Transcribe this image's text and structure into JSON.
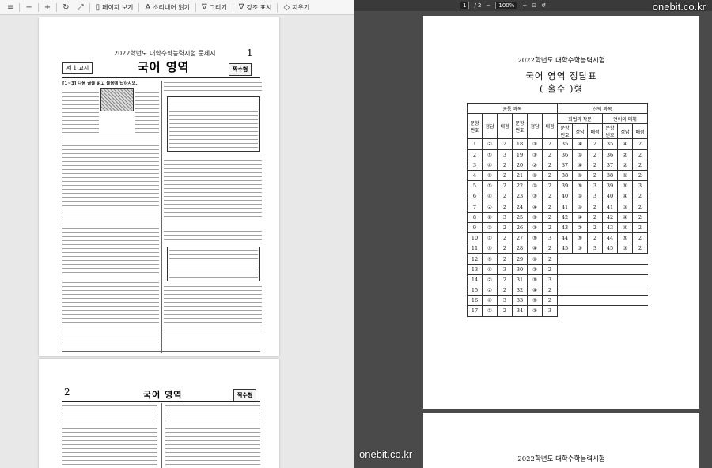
{
  "toolbar": {
    "items": [
      {
        "label": "",
        "icon": "menu-icon"
      },
      {
        "label": "",
        "icon": "minus-icon"
      },
      {
        "label": "",
        "icon": "plus-icon"
      },
      {
        "label": "",
        "icon": "rotate-icon"
      },
      {
        "label": "",
        "icon": "fit-icon"
      },
      {
        "label": "페이지 보기",
        "icon": "page-view-icon"
      },
      {
        "label": "소리내어 읽기",
        "icon": "read-aloud-icon"
      },
      {
        "label": "그리기",
        "icon": "draw-icon"
      },
      {
        "label": "강조 표시",
        "icon": "highlight-icon"
      },
      {
        "label": "지우기",
        "icon": "erase-icon"
      }
    ]
  },
  "left_doc": {
    "page1": {
      "exam_title": "2022학년도 대학수학능력시험 문제지",
      "page_number": "1",
      "session": "제 1 교시",
      "subject": "국어 영역",
      "type_badge": "짝수형",
      "q_intro_1": "[1~3] 다음 글을 읽고 물음에 답하시오."
    },
    "page2": {
      "page_number": "2",
      "subject": "국어 영역",
      "type_badge": "짝수형"
    }
  },
  "right_doc": {
    "toolbar": {
      "page": "1",
      "total": "/ 2",
      "zoom": "100%"
    },
    "watermark_top": "onebit.co.kr",
    "watermark_bottom": "onebit.co.kr",
    "page1": {
      "exam_title": "2022학년도 대학수학능력시험",
      "subject_line": "국어 영역 정답표",
      "type_line": "( 홀수 )형"
    },
    "page2": {
      "exam_title": "2022학년도 대학수학능력시험"
    },
    "table": {
      "group_common": "공통 과목",
      "group_elective": "선택 과목",
      "sub_a": "화법과 작문",
      "sub_b": "언어와 매체",
      "col_num": "문항 번호",
      "col_ans": "정답",
      "col_score": "배점",
      "common": [
        [
          "1",
          "②",
          "2"
        ],
        [
          "2",
          "⑤",
          "3"
        ],
        [
          "3",
          "④",
          "2"
        ],
        [
          "4",
          "①",
          "2"
        ],
        [
          "5",
          "⑤",
          "2"
        ],
        [
          "6",
          "④",
          "2"
        ],
        [
          "7",
          "②",
          "2"
        ],
        [
          "8",
          "②",
          "3"
        ],
        [
          "9",
          "③",
          "2"
        ],
        [
          "10",
          "①",
          "2"
        ],
        [
          "11",
          "⑤",
          "2"
        ],
        [
          "12",
          "⑤",
          "2"
        ],
        [
          "13",
          "④",
          "3"
        ],
        [
          "14",
          "②",
          "2"
        ],
        [
          "15",
          "②",
          "2"
        ],
        [
          "16",
          "④",
          "3"
        ],
        [
          "17",
          "①",
          "2"
        ]
      ],
      "common2": [
        [
          "18",
          "③",
          "2"
        ],
        [
          "19",
          "③",
          "2"
        ],
        [
          "20",
          "②",
          "2"
        ],
        [
          "21",
          "①",
          "2"
        ],
        [
          "22",
          "①",
          "2"
        ],
        [
          "23",
          "③",
          "2"
        ],
        [
          "24",
          "④",
          "2"
        ],
        [
          "25",
          "③",
          "2"
        ],
        [
          "26",
          "③",
          "2"
        ],
        [
          "27",
          "⑤",
          "3"
        ],
        [
          "28",
          "④",
          "2"
        ],
        [
          "29",
          "①",
          "2"
        ],
        [
          "30",
          "③",
          "2"
        ],
        [
          "31",
          "⑤",
          "3"
        ],
        [
          "32",
          "④",
          "2"
        ],
        [
          "33",
          "⑤",
          "2"
        ],
        [
          "34",
          "③",
          "3"
        ]
      ],
      "elective_a": [
        [
          "35",
          "④",
          "2"
        ],
        [
          "36",
          "①",
          "2"
        ],
        [
          "37",
          "④",
          "2"
        ],
        [
          "38",
          "①",
          "2"
        ],
        [
          "39",
          "⑤",
          "3"
        ],
        [
          "40",
          "①",
          "3"
        ],
        [
          "41",
          "①",
          "2"
        ],
        [
          "42",
          "④",
          "2"
        ],
        [
          "43",
          "②",
          "2"
        ],
        [
          "44",
          "⑤",
          "2"
        ],
        [
          "45",
          "③",
          "3"
        ]
      ],
      "elective_b": [
        [
          "35",
          "④",
          "2"
        ],
        [
          "36",
          "②",
          "2"
        ],
        [
          "37",
          "②",
          "2"
        ],
        [
          "38",
          "①",
          "2"
        ],
        [
          "39",
          "⑤",
          "3"
        ],
        [
          "40",
          "④",
          "2"
        ],
        [
          "41",
          "③",
          "2"
        ],
        [
          "42",
          "④",
          "2"
        ],
        [
          "43",
          "④",
          "2"
        ],
        [
          "44",
          "⑤",
          "2"
        ],
        [
          "45",
          "③",
          "2"
        ]
      ]
    }
  }
}
